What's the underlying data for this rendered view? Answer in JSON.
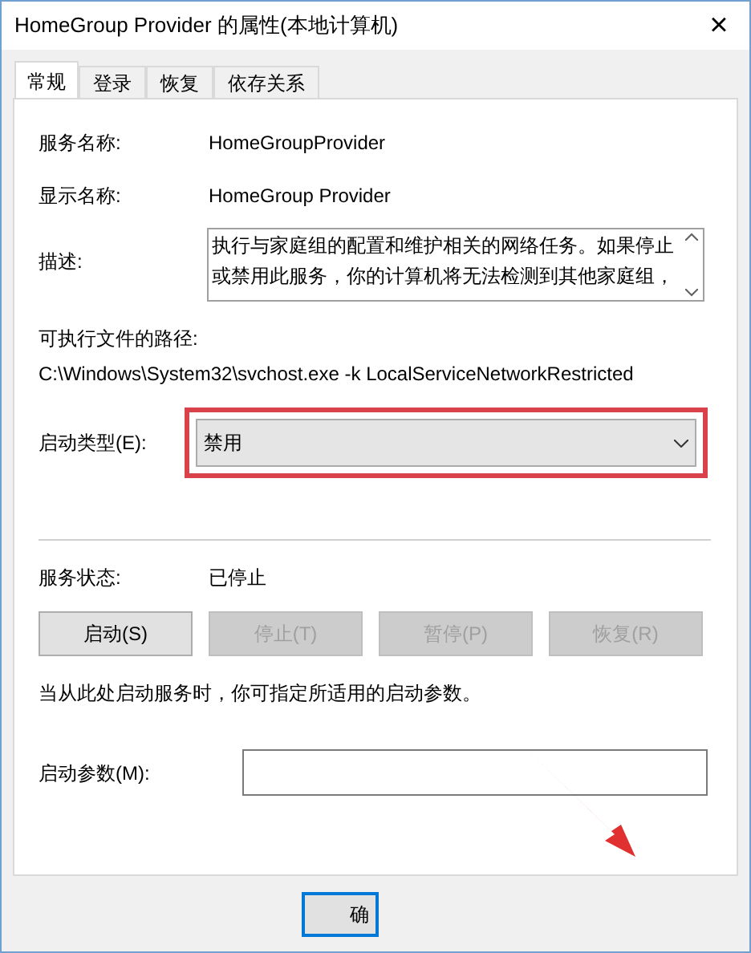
{
  "window": {
    "title": "HomeGroup Provider 的属性(本地计算机)",
    "close": "×"
  },
  "tabs": [
    {
      "label": "常规",
      "selected": true
    },
    {
      "label": "登录",
      "selected": false
    },
    {
      "label": "恢复",
      "selected": false
    },
    {
      "label": "依存关系",
      "selected": false
    }
  ],
  "service_name": {
    "label": "服务名称:",
    "value": "HomeGroupProvider"
  },
  "display_name": {
    "label": "显示名称:",
    "value": "HomeGroup Provider"
  },
  "description": {
    "label": "描述:",
    "value": "执行与家庭组的配置和维护相关的网络任务。如果停止或禁用此服务，你的计算机将无法检测到其他家庭组，"
  },
  "executable_path": {
    "label": "可执行文件的路径:",
    "value": "C:\\Windows\\System32\\svchost.exe -k LocalServiceNetworkRestricted"
  },
  "startup_type": {
    "label": "启动类型(E):",
    "value": "禁用",
    "highlighted": true
  },
  "service_status": {
    "label": "服务状态:",
    "value": "已停止"
  },
  "service_buttons": [
    {
      "label": "启动(S)",
      "disabled": false
    },
    {
      "label": "停止(T)",
      "disabled": true
    },
    {
      "label": "暂停(P)",
      "disabled": true
    },
    {
      "label": "恢复(R)",
      "disabled": true
    }
  ],
  "hint": "当从此处启动服务时，你可指定所适用的启动参数。",
  "start_parameters": {
    "label": "启动参数(M):"
  },
  "footer_buttons": [
    {
      "label": "确"
    }
  ]
}
